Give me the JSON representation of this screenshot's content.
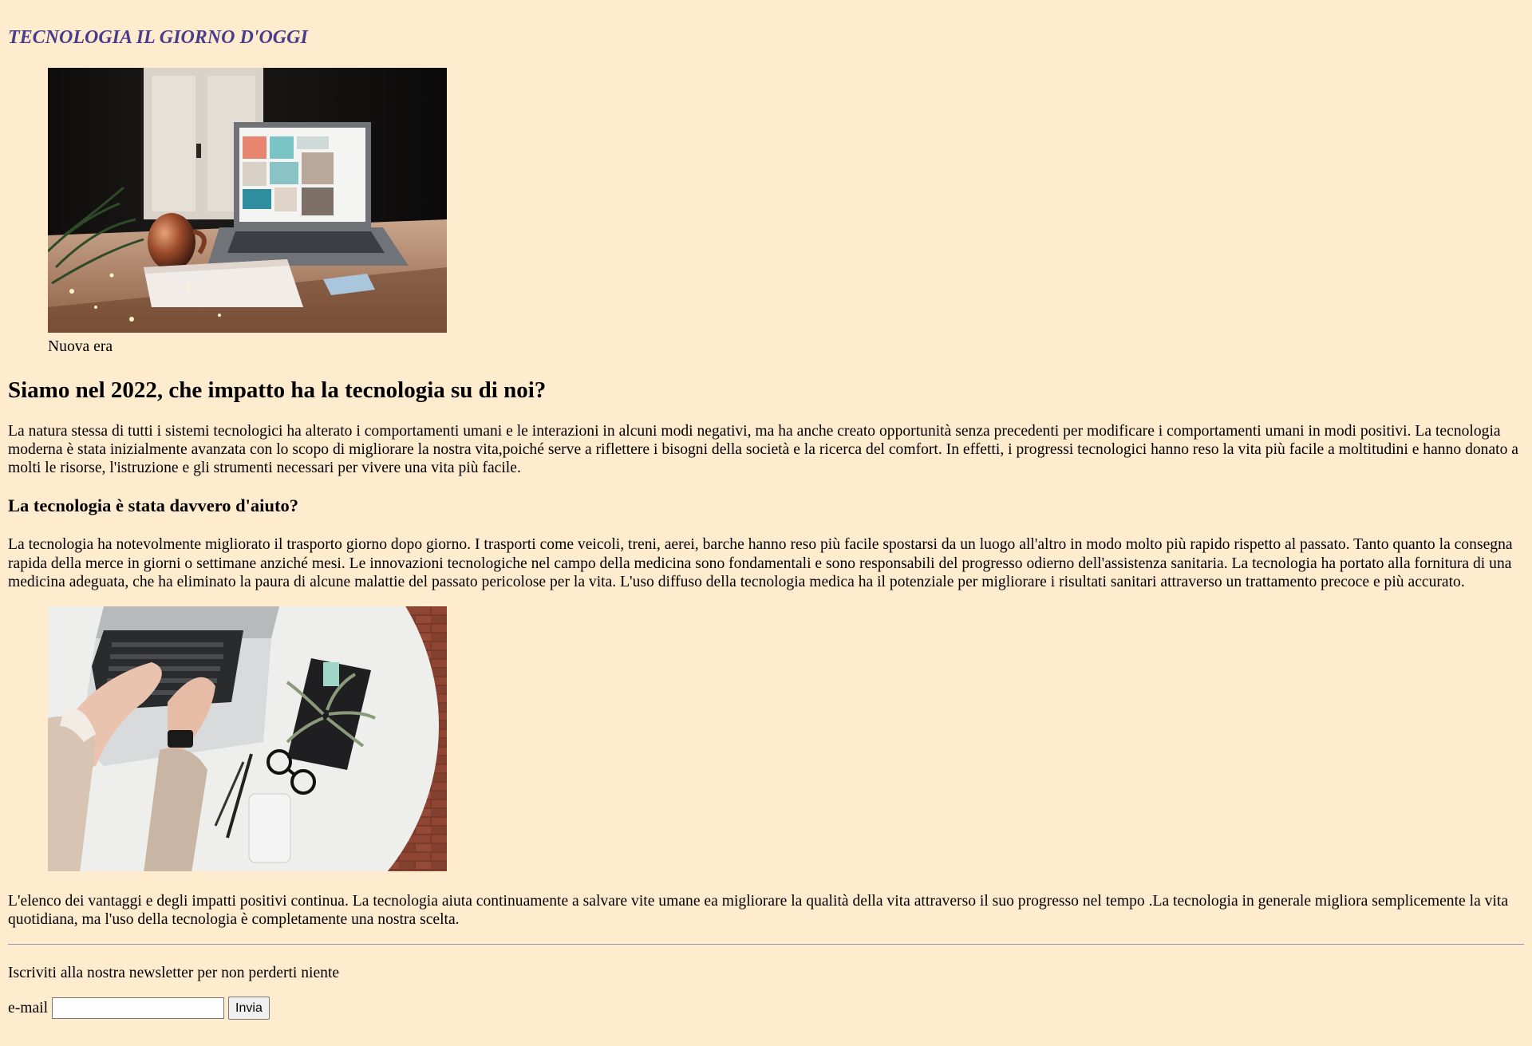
{
  "header": {
    "title": "TECNOLOGIA IL GIORNO D'OGGI"
  },
  "figure1": {
    "caption": "Nuova era",
    "image_icon": "laptop-desk-photo"
  },
  "article": {
    "heading": "Siamo nel 2022, che impatto ha la tecnologia su di noi?",
    "paragraph1": "La natura stessa di tutti i sistemi tecnologici ha alterato i comportamenti umani e le interazioni in alcuni modi negativi, ma ha anche creato opportunità senza precedenti per modificare i comportamenti umani in modi positivi. La tecnologia moderna è stata inizialmente avanzata con lo scopo di migliorare la nostra vita,poiché serve a riflettere i bisogni della società e la ricerca del comfort. In effetti, i progressi tecnologici hanno reso la vita più facile a moltitudini e hanno donato a molti le risorse, l'istruzione e gli strumenti necessari per vivere una vita più facile.",
    "subheading": "La tecnologia è stata davvero d'aiuto?",
    "paragraph2": "La tecnologia ha notevolmente migliorato il trasporto giorno dopo giorno. I trasporti come veicoli, treni, aerei, barche hanno reso più facile spostarsi da un luogo all'altro in modo molto più rapido rispetto al passato. Tanto quanto la consegna rapida della merce in giorni o settimane anziché mesi. Le innovazioni tecnologiche nel campo della medicina sono fondamentali e sono responsabili del progresso odierno dell'assistenza sanitaria. La tecnologia ha portato alla fornitura di una medicina adeguata, che ha eliminato la paura di alcune malattie del passato pericolose per la vita. L'uso diffuso della tecnologia medica ha il potenziale per migliorare i risultati sanitari attraverso un trattamento precoce e più accurato.",
    "paragraph3": "L'elenco dei vantaggi e degli impatti positivi continua. La tecnologia aiuta continuamente a salvare vite umane ea migliorare la qualità della vita attraverso il suo progresso nel tempo .La tecnologia in generale migliora semplicemente la vita quotidiana, ma l'uso della tecnologia è completamente una nostra scelta."
  },
  "figure2": {
    "image_icon": "typing-laptop-photo"
  },
  "newsletter": {
    "text": "Iscriviti alla nostra newsletter per non perderti niente",
    "email_label": "e-mail",
    "email_value": "",
    "submit_label": "Invia"
  },
  "colors": {
    "background": "#ffebcd",
    "title": "#483d8b"
  }
}
